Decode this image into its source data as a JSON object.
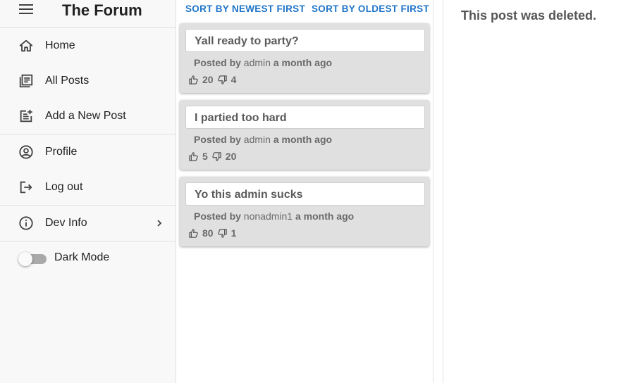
{
  "app": {
    "title": "The Forum"
  },
  "sidebar": {
    "nav_primary": [
      {
        "label": "Home",
        "icon": "home-icon"
      },
      {
        "label": "All Posts",
        "icon": "list-icon"
      },
      {
        "label": "Add a New Post",
        "icon": "post-add-icon"
      }
    ],
    "nav_account": [
      {
        "label": "Profile",
        "icon": "account-circle-icon"
      },
      {
        "label": "Log out",
        "icon": "logout-icon"
      }
    ],
    "dev_info": {
      "label": "Dev Info",
      "icon": "info-icon"
    },
    "dark_mode": {
      "label": "Dark Mode",
      "enabled": false
    }
  },
  "sort": {
    "newest_label": "SORT BY NEWEST FIRST",
    "oldest_label": "SORT BY OLDEST FIRST"
  },
  "posts": [
    {
      "title": "Yall ready to party?",
      "posted_by": "Posted by",
      "author": "admin",
      "time": "a month ago",
      "upvotes": "20",
      "downvotes": "4"
    },
    {
      "title": "I partied too hard",
      "posted_by": "Posted by",
      "author": "admin",
      "time": "a month ago",
      "upvotes": "5",
      "downvotes": "20"
    },
    {
      "title": "Yo this admin sucks",
      "posted_by": "Posted by",
      "author": "nonadmin1",
      "time": "a month ago",
      "upvotes": "80",
      "downvotes": "1"
    }
  ],
  "detail": {
    "message": "This post was deleted."
  },
  "colors": {
    "accent": "#1e74c8",
    "card_bg": "#e0e0e0",
    "sidebar_bg": "#f8f8f8"
  }
}
